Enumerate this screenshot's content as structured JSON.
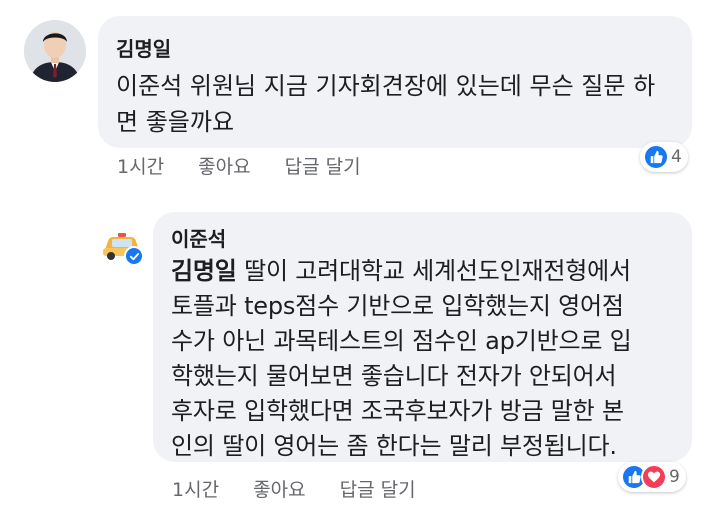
{
  "comments": [
    {
      "author": "김명일",
      "text": "이준석 위원님 지금 기자회견장에 있는데 무슨 질문 하면 좋을까요",
      "time": "1시간",
      "like_label": "좋아요",
      "reply_label": "답글 달기",
      "reaction_count": "4",
      "reactions": [
        "like-icon"
      ]
    },
    {
      "author": "이준석",
      "mention": "김명일",
      "text_lines": [
        " 딸이 고려대학교 세계선도인재전형에서",
        "토플과 teps점수 기반으로 입학했는지 영어점",
        "수가 아닌 과목테스트의 점수인 ap기반으로 입",
        "학했는지 물어보면 좋습니다  전자가 안되어서",
        "후자로 입학했다면 조국후보자가 방금 말한 본",
        "인의 딸이 영어는 좀 한다는 말리 부정됩니다."
      ],
      "time": "1시간",
      "like_label": "좋아요",
      "reply_label": "답글 달기",
      "reaction_count": "9",
      "reactions": [
        "like-icon",
        "love-icon"
      ],
      "verified": true
    }
  ],
  "colors": {
    "bubble": "#f0f2f5",
    "meta_text": "#65676b",
    "like": "#1877f2",
    "love": "#f33e58"
  }
}
